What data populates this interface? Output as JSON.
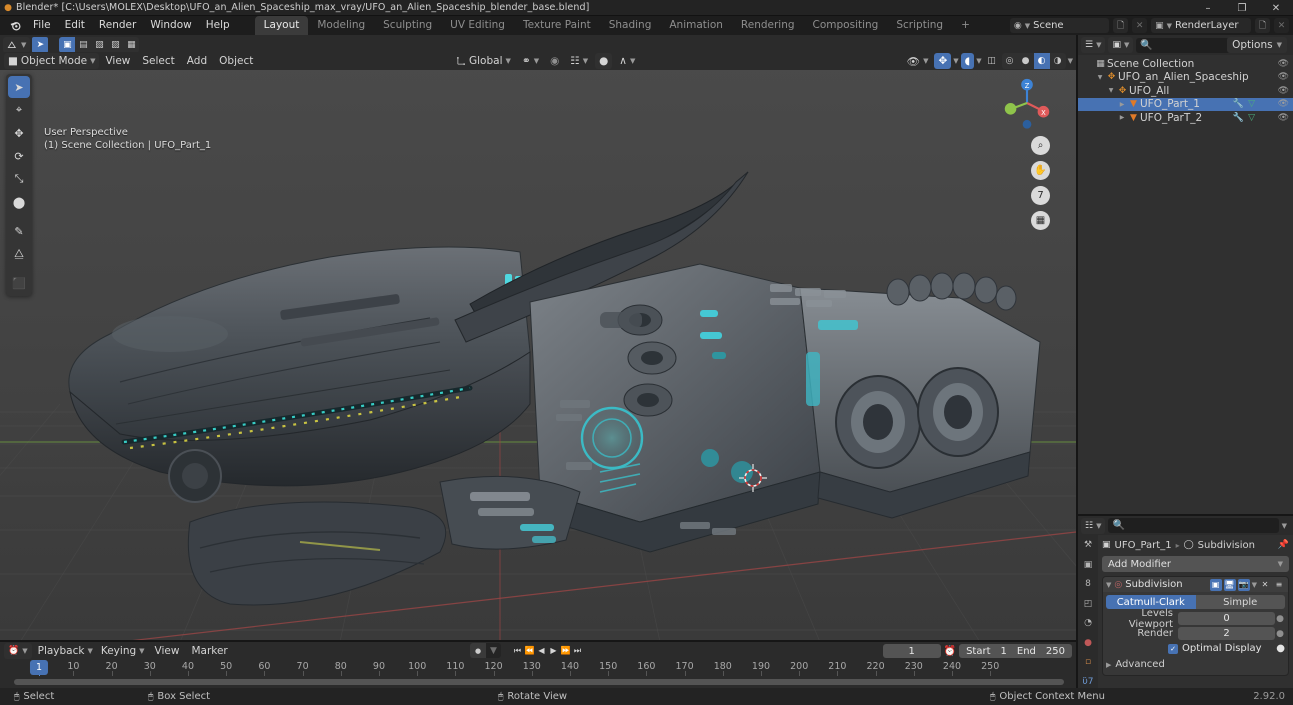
{
  "window": {
    "title": "Blender* [C:\\Users\\MOLEX\\Desktop\\UFO_an_Alien_Spaceship_max_vray/UFO_an_Alien_Spaceship_blender_base.blend]",
    "app_icon": "blender-logo-icon",
    "minimize": "–",
    "maximize": "❐",
    "close": "✕",
    "version": "2.92.0"
  },
  "menubar": {
    "items": [
      "File",
      "Edit",
      "Render",
      "Window",
      "Help"
    ]
  },
  "workspace_tabs": {
    "active": "Layout",
    "items": [
      "Layout",
      "Modeling",
      "Sculpting",
      "UV Editing",
      "Texture Paint",
      "Shading",
      "Animation",
      "Rendering",
      "Compositing",
      "Scripting"
    ],
    "add_label": "+"
  },
  "topbar_right": {
    "scene_label": "Scene",
    "viewlayer_label": "RenderLayer"
  },
  "viewport_header": {
    "mode": "Object Mode",
    "menus": [
      "View",
      "Select",
      "Add",
      "Object"
    ],
    "transform_orientation": "Global",
    "options_label": "Options"
  },
  "viewport": {
    "perspective": "User Perspective",
    "context": "(1) Scene Collection | UFO_Part_1",
    "tools": [
      {
        "name": "tweak-select-tool",
        "glyph": "➤",
        "active": true
      },
      {
        "name": "cursor-tool",
        "glyph": "⌖",
        "active": false
      },
      {
        "name": "move-tool",
        "glyph": "✥",
        "active": false
      },
      {
        "name": "rotate-tool",
        "glyph": "⟳",
        "active": false
      },
      {
        "name": "scale-tool",
        "glyph": "⤡",
        "active": false
      },
      {
        "name": "transform-tool",
        "glyph": "⬤",
        "active": false
      },
      {
        "name": "annotate-tool",
        "glyph": "✎",
        "active": false
      },
      {
        "name": "measure-tool",
        "glyph": "⧋",
        "active": false
      },
      {
        "name": "add-cube-tool",
        "glyph": "⬛",
        "active": false
      }
    ],
    "gizmo_axes": {
      "x": "X",
      "y": "Y",
      "z": "Z",
      "x_color": "#e05a5a",
      "y_color": "#8fc44b",
      "z_color": "#3d83d6"
    },
    "nav_buttons": [
      {
        "name": "zoom-view-icon",
        "glyph": "⌕"
      },
      {
        "name": "pan-view-icon",
        "glyph": "✋"
      },
      {
        "name": "camera-view-icon",
        "glyph": "὏7"
      },
      {
        "name": "toggle-ortho-icon",
        "glyph": "▦"
      }
    ]
  },
  "outliner": {
    "search_placeholder": "",
    "rows": [
      {
        "label": "Scene Collection",
        "depth": 0,
        "icon": "collection-icon",
        "disclosure": "",
        "eye": true,
        "modifier_icons": false,
        "selected": false
      },
      {
        "label": "UFO_an_Alien_Spaceship",
        "depth": 1,
        "icon": "collection-orange-icon",
        "disclosure": "▼",
        "eye": true,
        "modifier_icons": false,
        "selected": false
      },
      {
        "label": "UFO_All",
        "depth": 2,
        "icon": "collection-orange-icon",
        "disclosure": "▼",
        "eye": true,
        "modifier_icons": false,
        "selected": false
      },
      {
        "label": "UFO_Part_1",
        "depth": 3,
        "icon": "mesh-object-icon",
        "disclosure": "▶",
        "eye": true,
        "modifier_icons": true,
        "selected": true
      },
      {
        "label": "UFO_ParT_2",
        "depth": 3,
        "icon": "mesh-object-icon",
        "disclosure": "▶",
        "eye": true,
        "modifier_icons": true,
        "selected": false
      }
    ]
  },
  "properties": {
    "search_placeholder": "",
    "breadcrumb_object": "UFO_Part_1",
    "breadcrumb_modifier": "Subdivision",
    "add_modifier_label": "Add Modifier",
    "modifier": {
      "name": "Subdivision",
      "mode_options": [
        "Catmull-Clark",
        "Simple"
      ],
      "mode_selected": "Catmull-Clark",
      "levels_viewport_label": "Levels Viewport",
      "levels_viewport_value": "0",
      "render_label": "Render",
      "render_value": "2",
      "optimal_display_label": "Optimal Display",
      "optimal_display_checked": true,
      "advanced_label": "Advanced"
    },
    "tabs": [
      {
        "name": "tool-tab",
        "glyph": "⚒"
      },
      {
        "name": "render-tab",
        "glyph": "▣"
      },
      {
        "name": "output-tab",
        "glyph": "὚8"
      },
      {
        "name": "view-layer-tab",
        "glyph": "◰"
      },
      {
        "name": "scene-tab",
        "glyph": "◔"
      },
      {
        "name": "world-tab",
        "glyph": "●"
      },
      {
        "name": "object-tab",
        "glyph": "▫"
      },
      {
        "name": "modifier-tab",
        "glyph": "ὒ7"
      }
    ]
  },
  "timeline": {
    "menus": [
      "Playback",
      "Keying",
      "View",
      "Marker"
    ],
    "current_frame": "1",
    "start_label": "Start",
    "start_value": "1",
    "end_label": "End",
    "end_value": "250",
    "ticks": [
      10,
      20,
      30,
      40,
      50,
      60,
      70,
      80,
      90,
      100,
      110,
      120,
      130,
      140,
      150,
      160,
      170,
      180,
      190,
      200,
      210,
      220,
      230,
      240,
      250
    ],
    "playhead_label": "1",
    "transport": [
      "⏮",
      "⏪",
      "◀",
      "▶",
      "⏩",
      "⏭"
    ]
  },
  "statusbar": {
    "items": [
      {
        "mouse": "left-mouse-icon",
        "label": "Select"
      },
      {
        "mouse": "left-drag-mouse-icon",
        "label": "Box Select"
      },
      {
        "mouse": "middle-mouse-icon",
        "label": "Rotate View"
      },
      {
        "mouse": "right-mouse-icon",
        "label": "Object Context Menu"
      }
    ]
  },
  "colors": {
    "accent": "#4772b3",
    "panel_bg": "#303030",
    "header_bg": "#2b2b2b",
    "viewport_bg": "#434343",
    "text": "#d4d4d4"
  }
}
